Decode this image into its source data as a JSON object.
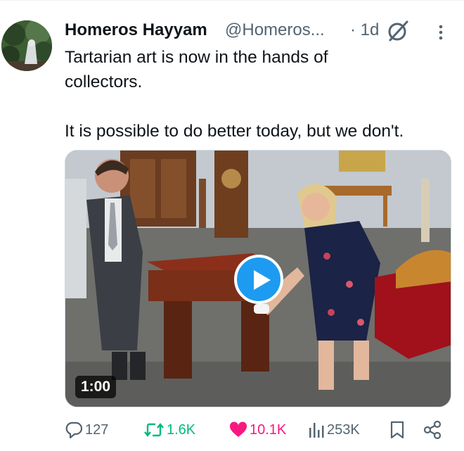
{
  "tweet": {
    "author_name": "Homeros Hayyam",
    "author_handle": "@Homeros...",
    "time": "· 1d",
    "text": "Tartarian art is now in the hands of\ncollectors.\n\nIt is possible to do better today, but we don't.",
    "media": {
      "duration": "1:00"
    },
    "actions": {
      "replies": "127",
      "reposts": "1.6K",
      "likes": "10.1K",
      "views": "253K"
    }
  },
  "icons": {
    "grok": "grok-icon",
    "more": "more-options-icon",
    "reply": "reply-icon",
    "repost": "repost-icon",
    "like": "heart-icon",
    "views": "views-icon",
    "bookmark": "bookmark-icon",
    "share": "share-icon",
    "play": "play-icon"
  },
  "colors": {
    "accent": "#1d9bf0",
    "repost_active": "#00ba7c",
    "like_active": "#f91880",
    "secondary_text": "#536471"
  }
}
